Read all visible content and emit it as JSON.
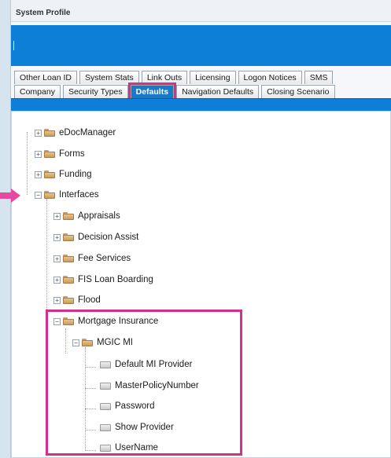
{
  "window": {
    "title": "System Profile"
  },
  "tabs": {
    "row1": [
      "Other Loan ID",
      "System Stats",
      "Link Outs",
      "Licensing",
      "Logon Notices",
      "SMS"
    ],
    "row2": [
      "Company",
      "Security Types",
      "Defaults",
      "Navigation Defaults",
      "Closing Scenario"
    ],
    "active": "Defaults"
  },
  "tree": {
    "edocmanager": "eDocManager",
    "forms": "Forms",
    "funding": "Funding",
    "interfaces": "Interfaces",
    "appraisals": "Appraisals",
    "decision_assist": "Decision Assist",
    "fee_services": "Fee Services",
    "fis_loan_boarding": "FIS Loan Boarding",
    "flood": "Flood",
    "mortgage_insurance": "Mortgage Insurance",
    "mgic_mi": "MGIC MI",
    "default_mi_provider": "Default MI Provider",
    "master_policy_number": "MasterPolicyNumber",
    "password": "Password",
    "show_provider": "Show Provider",
    "username": "UserName"
  },
  "expanders": {
    "collapsed": "+",
    "expanded": "−"
  },
  "colors": {
    "accent_blue": "#0d7fd6",
    "highlight_pink": "#d62f8a",
    "active_tab": "#1b78c4"
  }
}
